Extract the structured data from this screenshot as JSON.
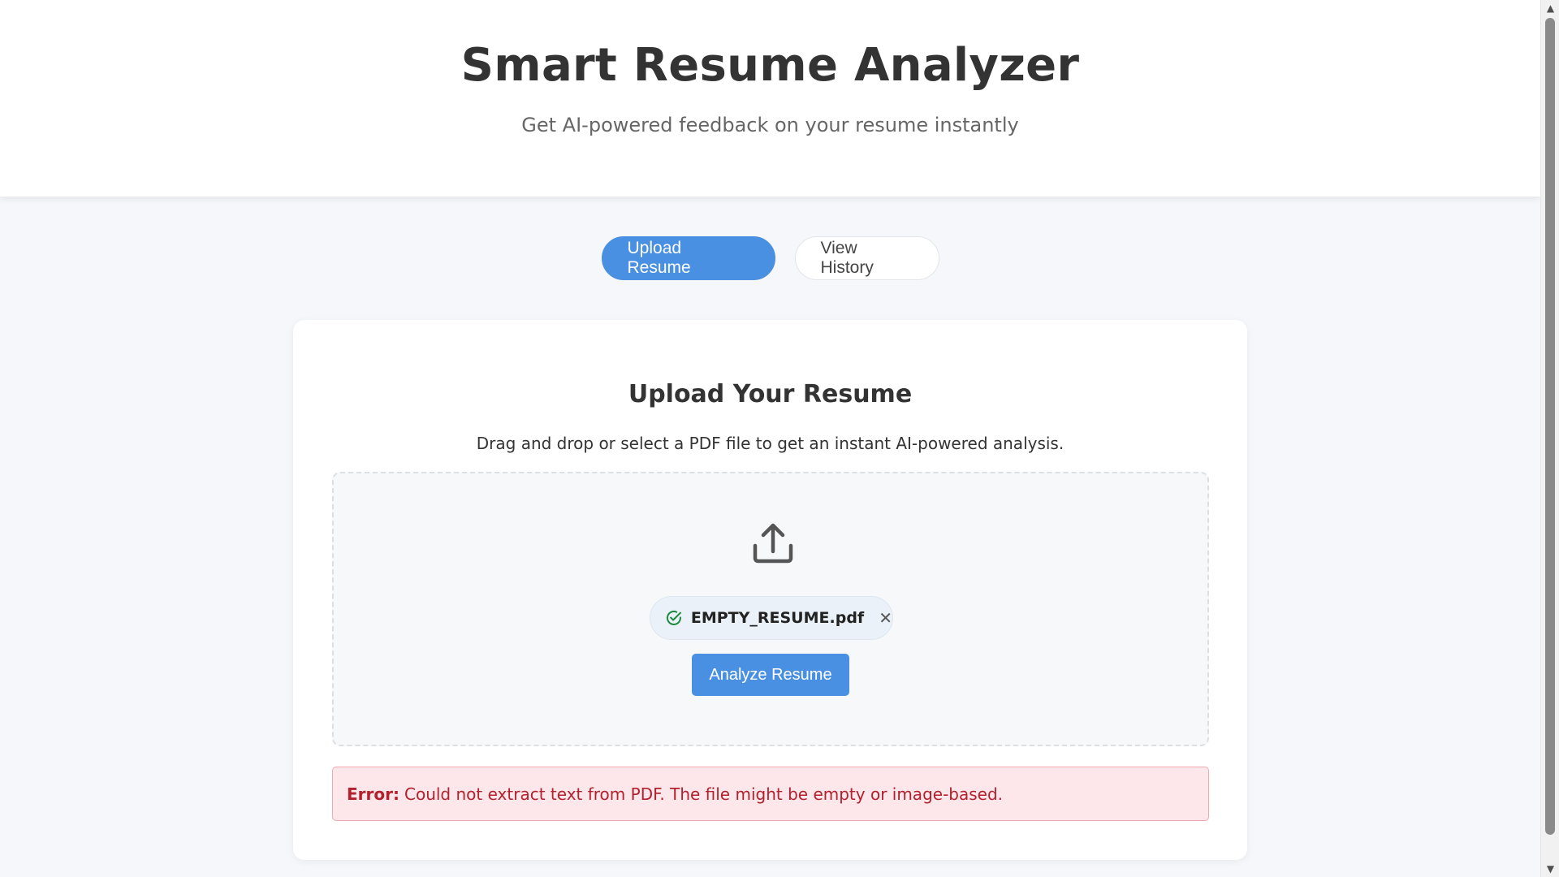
{
  "header": {
    "title": "Smart Resume Analyzer",
    "subtitle": "Get AI-powered feedback on your resume instantly"
  },
  "tabs": [
    {
      "label": "Upload Resume",
      "active": true
    },
    {
      "label": "View History",
      "active": false
    }
  ],
  "upload_card": {
    "title": "Upload Your Resume",
    "description": "Drag and drop or select a PDF file to get an instant AI-powered analysis.",
    "upload_icon": "upload-icon",
    "file": {
      "name": "EMPTY_RESUME.pdf",
      "status_icon": "check-circle-icon",
      "remove_glyph": "✕"
    },
    "analyze_label": "Analyze Resume"
  },
  "error": {
    "label": "Error:",
    "message": "Could not extract text from PDF. The file might be empty or image-based."
  },
  "scrollbar": {
    "up_glyph": "▲",
    "down_glyph": "▼"
  },
  "colors": {
    "accent": "#4a90e2",
    "success": "#1e8a3c",
    "error_text": "#b3202e",
    "error_bg": "#fde7ea",
    "page_bg": "#f5f7fa"
  }
}
